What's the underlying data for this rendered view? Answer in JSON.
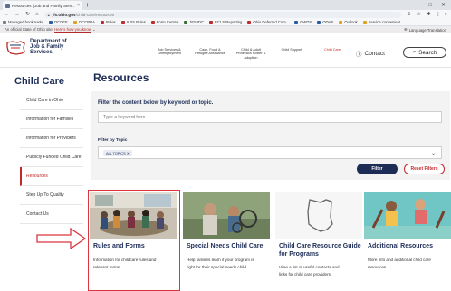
{
  "browser": {
    "tab_title": "Resources | Job and Family Servi...",
    "tab_close": "×",
    "new_tab": "+",
    "url_host": "jfs.ohio.gov",
    "url_path": "/child-care/resources",
    "bookmarks": [
      {
        "label": "Managed bookmarks",
        "color": "#7a7a7a"
      },
      {
        "label": "DCCEE",
        "color": "#2c5aa0"
      },
      {
        "label": "OCCRRA",
        "color": "#e0a020"
      },
      {
        "label": "Rules",
        "color": "#c0292b"
      },
      {
        "label": "ILRS Rules",
        "color": "#c0292b"
      },
      {
        "label": "Form Central",
        "color": "#c0292b"
      },
      {
        "label": "JFS IDC",
        "color": "#3a6e3a"
      },
      {
        "label": "ECLS Reporting",
        "color": "#c0292b"
      },
      {
        "label": "Ohio Deferred Com...",
        "color": "#c0292b"
      },
      {
        "label": "OWDS",
        "color": "#2c5aa0"
      },
      {
        "label": "ODHS",
        "color": "#2c5aa0"
      },
      {
        "label": "Outlook",
        "color": "#e0a020"
      },
      {
        "label": "Service convenient...",
        "color": "#e0a020"
      }
    ]
  },
  "gov_bar": {
    "text": "An official State of Ohio site.",
    "link": "Here's how you know",
    "translate": "Language Translation"
  },
  "header": {
    "logo_lines": [
      "Department of",
      "Job & Family",
      "Services"
    ],
    "nav": [
      {
        "label": "Job Services & Unemployment",
        "active": false
      },
      {
        "label": "Cash, Food & Refugee Assistance",
        "active": false
      },
      {
        "label": "Child & Adult Protection Foster & Adoption",
        "active": false
      },
      {
        "label": "Child Support",
        "active": false
      },
      {
        "label": "Child Care",
        "active": true
      }
    ],
    "contact": "Contact",
    "search": "Search"
  },
  "sidebar": {
    "title": "Child Care",
    "items": [
      {
        "label": "Child Care in Ohio",
        "active": false
      },
      {
        "label": "Information for Families",
        "active": false
      },
      {
        "label": "Information for Providers",
        "active": false
      },
      {
        "label": "Publicly Funded Child Care",
        "active": false
      },
      {
        "label": "Resources",
        "active": true
      },
      {
        "label": "Step Up To Quality",
        "active": false
      },
      {
        "label": "Contact Us",
        "active": false
      }
    ]
  },
  "main": {
    "title": "Resources",
    "filter": {
      "heading": "Filter the content below by keyword or topic.",
      "keyword_placeholder": "Type a keyword here",
      "topic_label": "Filter by Topic",
      "topic_chip": "ALL TOPICS ✕",
      "filter_button": "Filter",
      "reset_button": "Reset Filters"
    },
    "cards": [
      {
        "title": "Rules and Forms",
        "desc_lines": [
          "Information for childcare rules and",
          "relevant forms."
        ],
        "image": "classroom-photo"
      },
      {
        "title": "Special Needs Child Care",
        "desc_lines": [
          "Help families learn if your program is",
          "right for their special needs child."
        ],
        "image": "family-photo"
      },
      {
        "title_lines": [
          "Child Care Resource Guide",
          "for Programs"
        ],
        "desc_lines": [
          "View a list of useful contacts and",
          "links for child care providers"
        ],
        "image": "ohio-outline"
      },
      {
        "title": "Additional Resources",
        "desc_lines": [
          "More info and additional child care",
          "resources."
        ],
        "image": "children-photo"
      }
    ]
  },
  "colors": {
    "navy": "#1c2c55",
    "accent_red": "#c0292b",
    "highlight": "#d9363e"
  }
}
